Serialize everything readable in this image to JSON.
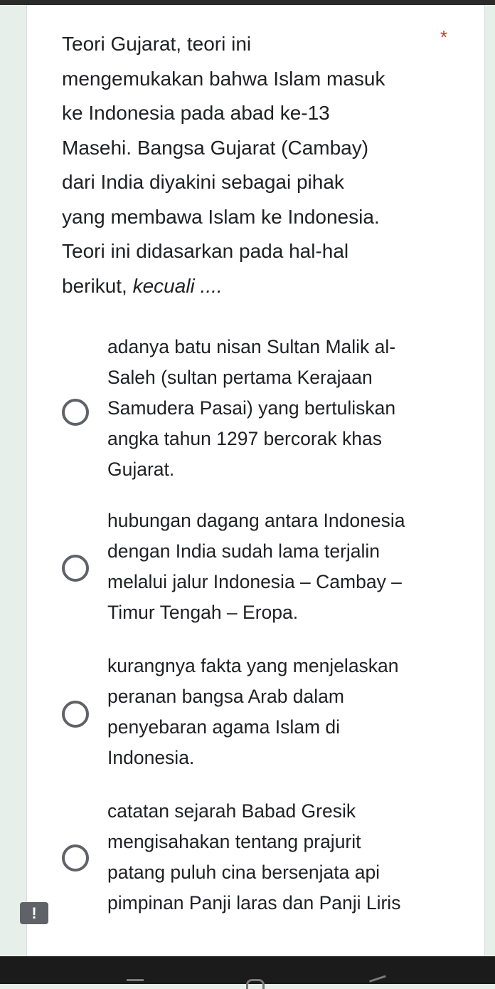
{
  "question": {
    "text": "Teori Gujarat, teori ini\nmengemukakan bahwa Islam masuk\nke Indonesia pada abad ke-13\nMasehi. Bangsa Gujarat (Cambay)\ndari India diyakini sebagai pihak\nyang membawa Islam ke Indonesia.\nTeori ini didasarkan pada hal-hal\nberikut, ",
    "emphasis": "kecuali ....",
    "required_marker": "*"
  },
  "options": [
    {
      "label": "adanya batu nisan Sultan Malik al-\nSaleh (sultan pertama Kerajaan\nSamudera Pasai) yang bertuliskan\nangka tahun 1297 bercorak khas\nGujarat.",
      "selected": false
    },
    {
      "label": "hubungan dagang antara Indonesia\ndengan India sudah lama terjalin\nmelalui jalur Indonesia – Cambay –\nTimur Tengah – Eropa.",
      "selected": false
    },
    {
      "label": "kurangnya fakta yang menjelaskan\nperanan bangsa Arab dalam\npenyebaran agama Islam di\nIndonesia.",
      "selected": false
    },
    {
      "label": "catatan sejarah Babad Gresik\nmengisahakan tentang prajurit\npatang puluh cina bersenjata api\npimpinan Panji laras dan Panji Liris",
      "selected": false
    }
  ],
  "error_badge": "!",
  "colors": {
    "page_background": "#e7efeb",
    "card_background": "#ffffff",
    "required": "#d93025",
    "radio_border": "#5f6368",
    "nav_bar": "#1b1b1b"
  },
  "icons": {
    "radio": "radio-unchecked",
    "error": "exclamation-badge",
    "nav": [
      "recent-apps-icon",
      "home-icon",
      "back-icon"
    ]
  }
}
